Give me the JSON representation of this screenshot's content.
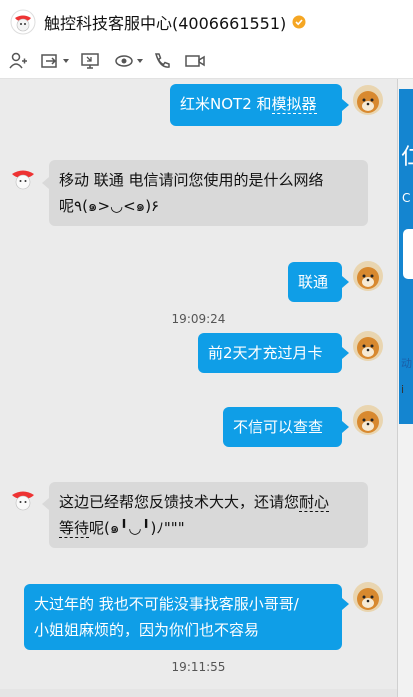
{
  "header": {
    "title": "触控科技客服中心(4006661551)",
    "verified_icon": "verified-badge-icon",
    "logo_icon": "service-logo-icon"
  },
  "toolbar": {
    "items": [
      {
        "name": "add-contact-icon"
      },
      {
        "name": "transfer-file-icon"
      },
      {
        "name": "screen-share-icon"
      },
      {
        "name": "remote-assist-icon"
      },
      {
        "name": "voice-call-icon"
      },
      {
        "name": "video-call-icon"
      }
    ]
  },
  "messages": [
    {
      "from": "me",
      "parts": [
        "红米NOT2  和",
        "模拟器"
      ]
    },
    {
      "from": "them",
      "lines": [
        "移动 联通 电信请问您使用的是什么网络",
        "呢٩(๑>◡<๑)۶"
      ]
    },
    {
      "from": "me",
      "text": "联通"
    },
    {
      "from": "time",
      "text": "19:09:24"
    },
    {
      "from": "me",
      "text": "前2天才充过月卡"
    },
    {
      "from": "me",
      "text": "不信可以查查"
    },
    {
      "from": "them",
      "parts": [
        "这边已经帮您反馈技术大大，还请您",
        "耐心",
        "等待",
        "呢(๑╹◡╹)ﾉ\"\"\""
      ]
    },
    {
      "from": "me",
      "lines": [
        "大过年的 我也不可能没事找客服小哥哥/",
        "小姐姐麻烦的，因为你们也不容易"
      ]
    },
    {
      "from": "time",
      "text": "19:11:55"
    }
  ],
  "side_panel": {
    "glyph_top": "仁",
    "glyph_c": "C",
    "glyph_mid": "动",
    "glyph_low": "i"
  },
  "colors": {
    "my_bubble": "#0f9ee7",
    "their_bubble": "#d9d9d9",
    "chat_bg": "#ebebeb"
  }
}
